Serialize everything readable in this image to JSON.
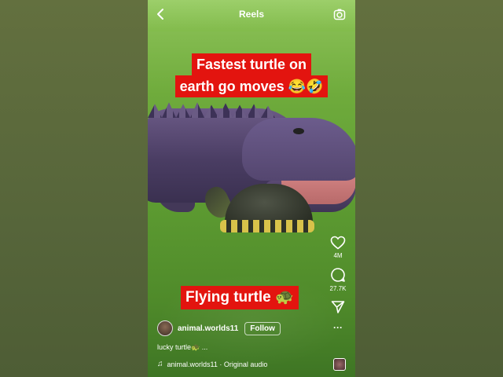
{
  "header": {
    "title": "Reels"
  },
  "video": {
    "caption_line1": "Fastest turtle on",
    "caption_line2": "earth go moves 😂🤣",
    "overlay_text": "Flying turtle 🐢"
  },
  "actions": {
    "like_count": "4M",
    "comment_count": "27.7K",
    "more_label": "···"
  },
  "post": {
    "username": "animal.worlds11",
    "follow_label": "Follow",
    "description": "lucky turtle🐢 ...",
    "audio": "animal.worlds11 · Original audio"
  },
  "colors": {
    "caption_bg": "#e3140f",
    "background": "#5b6a3a"
  },
  "icons": [
    "back-icon",
    "camera-icon",
    "heart-icon",
    "comment-icon",
    "share-icon",
    "more-icon",
    "music-note-icon"
  ]
}
